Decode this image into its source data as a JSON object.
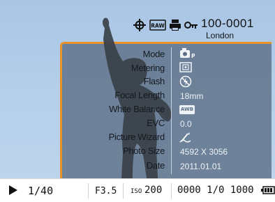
{
  "header": {
    "file_number": "100-0001",
    "location": "London",
    "icons": [
      "focus-crosshair-icon",
      "raw-icon",
      "print-icon",
      "protect-key-icon"
    ],
    "raw_badge": "RAW"
  },
  "info": {
    "rows": [
      {
        "label": "Mode",
        "value": "",
        "icon": "program-mode-icon"
      },
      {
        "label": "Metering",
        "value": "",
        "icon": "metering-icon"
      },
      {
        "label": "Flash",
        "value": "",
        "icon": "flash-off-icon"
      },
      {
        "label": "Focal Length",
        "value": "18mm"
      },
      {
        "label": "White Balance",
        "value": "AWB",
        "icon": "awb-badge"
      },
      {
        "label": "EVC",
        "value": "0.0"
      },
      {
        "label": "Picture Wizard",
        "value": "",
        "icon": "picture-wizard-icon"
      },
      {
        "label": "Photo Size",
        "value": "4592 X 3056"
      },
      {
        "label": "Date",
        "value": "2011.01.01"
      }
    ]
  },
  "bottom": {
    "play_icon": "play-icon",
    "shutter": "1/40",
    "aperture": "F3.5",
    "iso_prefix": "ISO",
    "iso_value": "200",
    "counter": "0000 1/0 1000",
    "battery_icon": "battery-icon"
  },
  "colors": {
    "panel_border": "#e8922b",
    "panel_fill": "#5d7088",
    "sky": "#b6d0ea"
  }
}
